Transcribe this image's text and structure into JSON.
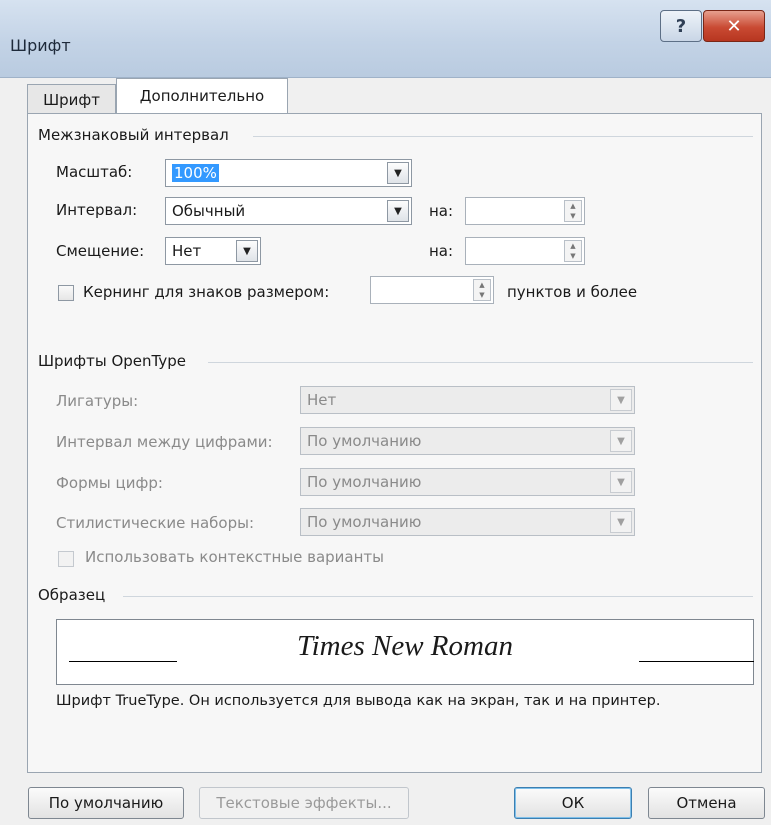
{
  "window": {
    "title": "Шрифт",
    "help_glyph": "?",
    "close_glyph": "✕"
  },
  "tabs": [
    {
      "label": "Шрифт",
      "selected": false
    },
    {
      "label": "Дополнительно",
      "selected": true
    }
  ],
  "spacing": {
    "group_title": "Межзнаковый интервал",
    "scale": {
      "label": "Масштаб:",
      "value": "100%"
    },
    "interval": {
      "label": "Интервал:",
      "value": "Обычный",
      "by_label": "на:",
      "by_value": ""
    },
    "offset": {
      "label": "Смещение:",
      "value": "Нет",
      "by_label": "на:",
      "by_value": ""
    },
    "kerning": {
      "label": "Кернинг для знаков размером:",
      "value": "",
      "suffix": "пунктов и более",
      "checked": false
    }
  },
  "opentype": {
    "group_title": "Шрифты OpenType",
    "ligatures": {
      "label": "Лигатуры:",
      "value": "Нет"
    },
    "number_spacing": {
      "label": "Интервал между цифрами:",
      "value": "По умолчанию"
    },
    "number_forms": {
      "label": "Формы цифр:",
      "value": "По умолчанию"
    },
    "stylistic_sets": {
      "label": "Стилистические наборы:",
      "value": "По умолчанию"
    },
    "contextual": {
      "label": "Использовать контекстные варианты",
      "checked": false
    }
  },
  "preview": {
    "group_title": "Образец",
    "sample_text": "Times New Roman",
    "description": "Шрифт TrueType. Он используется для вывода как на экран, так и на принтер."
  },
  "buttons": {
    "default": "По умолчанию",
    "text_effects": "Текстовые эффекты...",
    "ok": "ОК",
    "cancel": "Отмена"
  },
  "colors": {
    "title_bar": "#c3d3e6",
    "close_button": "#c94a33",
    "selection": "#3399ff"
  }
}
